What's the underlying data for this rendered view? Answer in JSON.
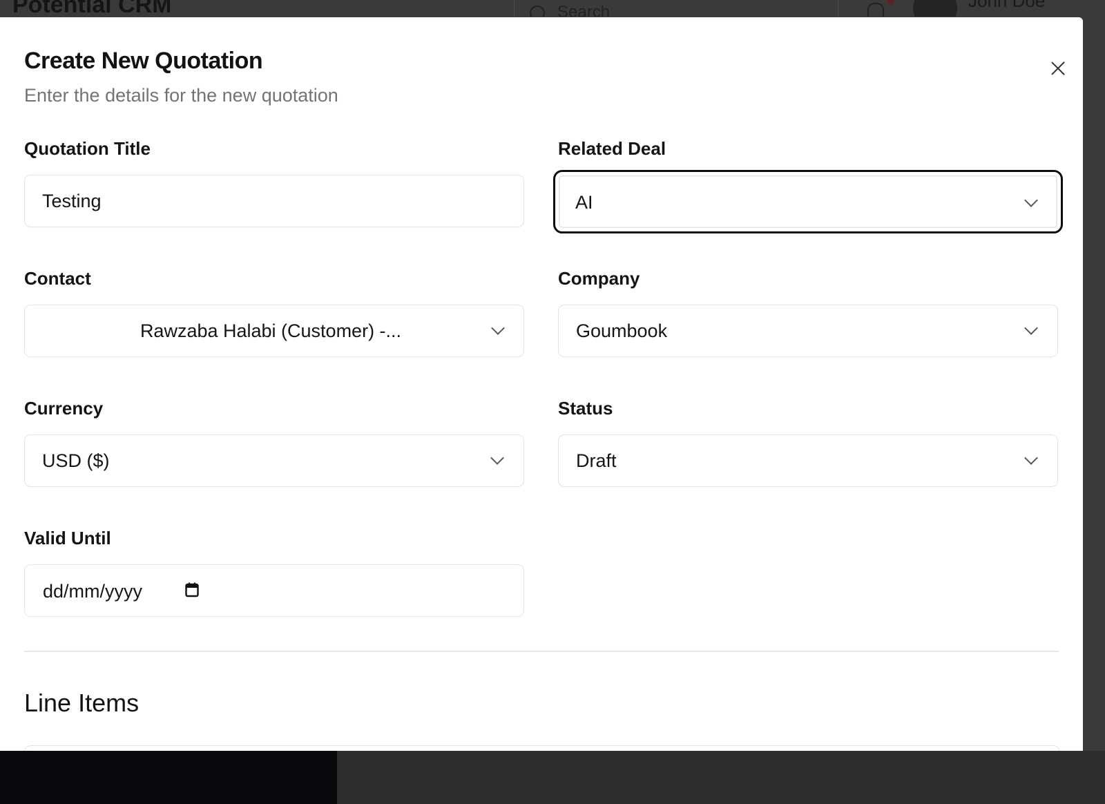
{
  "app": {
    "title": "Potential CRM",
    "search_placeholder": "Search",
    "user_name": "John Doe"
  },
  "modal": {
    "title": "Create New Quotation",
    "subtitle": "Enter the details for the new quotation",
    "fields": {
      "quotation_title": {
        "label": "Quotation Title",
        "value": "Testing"
      },
      "related_deal": {
        "label": "Related Deal",
        "value": "AI"
      },
      "contact": {
        "label": "Contact",
        "value": "Rawzaba Halabi (Customer) -..."
      },
      "company": {
        "label": "Company",
        "value": "Goumbook"
      },
      "currency": {
        "label": "Currency",
        "value": "USD ($)"
      },
      "status": {
        "label": "Status",
        "value": "Draft"
      },
      "valid_until": {
        "label": "Valid Until",
        "placeholder": "dd/mm/yyyy"
      }
    },
    "line_items_title": "Line Items"
  },
  "icons": {
    "close": "close-icon",
    "chevron": "chevron-down-icon",
    "calendar": "calendar-icon",
    "search": "search-icon",
    "bell": "bell-icon"
  }
}
